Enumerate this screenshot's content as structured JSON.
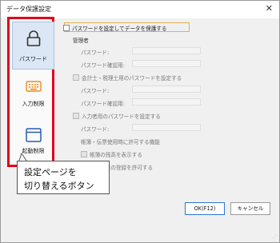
{
  "window": {
    "title": "データ保護設定",
    "close_glyph": "✕"
  },
  "sidebar": {
    "items": [
      {
        "label": "パスワード",
        "icon": "lock-icon",
        "active": true
      },
      {
        "label": "入力制限",
        "icon": "keyboard-icon",
        "active": false
      },
      {
        "label": "起動制限",
        "icon": "window-icon",
        "active": false
      }
    ]
  },
  "content": {
    "protect_checkbox": "パスワードを設定してデータを保護する",
    "admin_group": "管理者",
    "admin_password_label": "パスワード:",
    "admin_password_confirm_label": "パスワード確認用:",
    "accountant_checkbox": "会計士・税理士用のパスワードを設定する",
    "accountant_password_label": "パスワード:",
    "accountant_password_confirm_label": "パスワード確認用:",
    "inputter_checkbox": "入力者用のパスワードを設定する",
    "inputter_password_label": "パスワード:",
    "inputter_features_label": "帳簿・伝票使用時に許可する機能",
    "show_balance_checkbox": "帳簿の残高を表示する",
    "allow_subaccount_checkbox": "補助科目の登録を許可する"
  },
  "callout": {
    "line1": "設定ページを",
    "line2": "切り替えるボタン"
  },
  "buttons": {
    "ok": "OK(F12)",
    "cancel": "キャンセル"
  },
  "colors": {
    "highlight_border": "#e0001a",
    "accent": "#2a78d0",
    "icon_orange": "#f08a1c",
    "icon_blue": "#2a5db0"
  }
}
